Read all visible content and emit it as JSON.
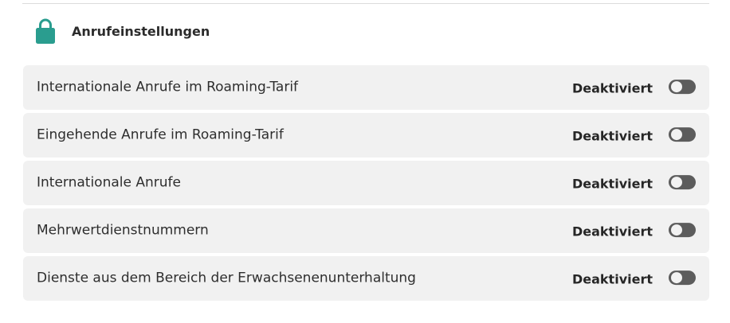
{
  "section": {
    "title": "Anrufeinstellungen",
    "icon": "lock-icon",
    "accent_color": "#2a9d8f"
  },
  "settings": [
    {
      "label": "Internationale Anrufe im Roaming-Tarif",
      "status": "Deaktiviert",
      "enabled": false
    },
    {
      "label": "Eingehende Anrufe im Roaming-Tarif",
      "status": "Deaktiviert",
      "enabled": false
    },
    {
      "label": "Internationale Anrufe",
      "status": "Deaktiviert",
      "enabled": false
    },
    {
      "label": "Mehrwertdienstnummern",
      "status": "Deaktiviert",
      "enabled": false
    },
    {
      "label": "Dienste aus dem Bereich der Erwachsenenunterhaltung",
      "status": "Deaktiviert",
      "enabled": false
    }
  ]
}
